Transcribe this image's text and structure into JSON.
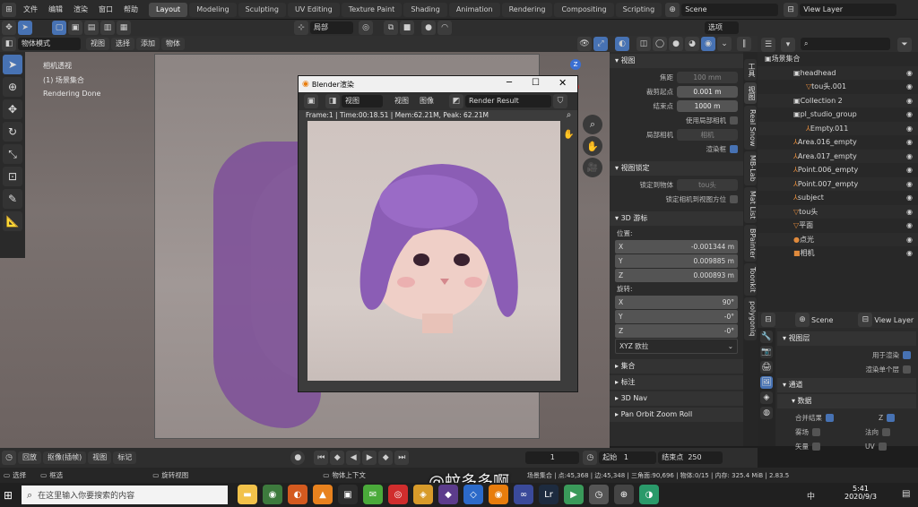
{
  "topbar": {
    "menus": [
      "文件",
      "编辑",
      "渲染",
      "窗口",
      "帮助"
    ],
    "workspaces": [
      "Layout",
      "Modeling",
      "Sculpting",
      "UV Editing",
      "Texture Paint",
      "Shading",
      "Animation",
      "Rendering",
      "Compositing",
      "Scripting"
    ],
    "active_workspace": "Layout",
    "scene": "Scene",
    "view_layer": "View Layer"
  },
  "toolbar2": {
    "orientation": "局部",
    "options": "选项"
  },
  "viewport_header": {
    "mode": "物体模式",
    "menus": [
      "视图",
      "选择",
      "添加",
      "物体"
    ]
  },
  "viewport": {
    "camera_label": "相机透视",
    "collection_label": "(1) 场景集合",
    "status": "Rendering Done"
  },
  "render_window": {
    "title": "Blender渲染",
    "view_menu": "视图",
    "menus": [
      "视图",
      "图像"
    ],
    "slot": "Render Result",
    "stats": "Frame:1 | Time:00:18.51 | Mem:62.21M, Peak: 62.21M"
  },
  "npanel": {
    "view_section": "视图",
    "focal_label": "焦距",
    "focal_value": "100 mm",
    "clip_start_label": "裁剪起点",
    "clip_start_value": "0.001 m",
    "clip_end_label": "结束点",
    "clip_end_value": "1000 m",
    "local_camera_label": "使用局部相机",
    "local_camera_field_label": "局部相机",
    "local_camera_value": "相机",
    "render_region_label": "渲染框",
    "view_lock_section": "视图锁定",
    "lock_to_object_label": "锁定到物体",
    "lock_to_object_value": "tou头",
    "lock_camera_label": "锁定相机到视图方位",
    "cursor_section": "3D 游标",
    "location_label": "位置:",
    "loc_x": "-0.001344 m",
    "loc_y": "0.009885 m",
    "loc_z": "0.000893 m",
    "rotation_label": "旋转:",
    "rot_x": "90°",
    "rot_y": "-0°",
    "rot_z": "-0°",
    "rotation_mode": "XYZ 欧拉",
    "collections_section": "集合",
    "annotations_section": "标注",
    "nav_section": "3D Nav",
    "pan_section": "Pan Orbit Zoom Roll"
  },
  "vtabs": [
    "工具",
    "视图",
    "Real Snow",
    "MB-Lab",
    "Mat List",
    "BPainter",
    "Toonkit",
    "polygoniq"
  ],
  "outliner": {
    "title": "场景集合",
    "items": [
      {
        "name": "headhead",
        "icon": "▣"
      },
      {
        "name": "tou头.001",
        "icon": "▽"
      },
      {
        "name": "Collection 2",
        "icon": "▣"
      },
      {
        "name": "pl_studio_group",
        "icon": "▣"
      },
      {
        "name": "Empty.011",
        "icon": "⅄"
      },
      {
        "name": "Area.016_empty",
        "icon": "⅄"
      },
      {
        "name": "Area.017_empty",
        "icon": "⅄"
      },
      {
        "name": "Point.006_empty",
        "icon": "⅄"
      },
      {
        "name": "Point.007_empty",
        "icon": "⅄"
      },
      {
        "name": "subject",
        "icon": "⅄"
      },
      {
        "name": "tou头",
        "icon": "▽"
      },
      {
        "name": "平面",
        "icon": "▽"
      },
      {
        "name": "点光",
        "icon": "●"
      },
      {
        "name": "相机",
        "icon": "■"
      }
    ]
  },
  "props2": {
    "scene": "Scene",
    "view_layer": "View Layer",
    "layer_section": "视图层",
    "use_for_render": "用于渲染",
    "render_single": "渲染单个层",
    "passes_section": "通道",
    "data_section": "数据",
    "combined": "合并结果",
    "z": "Z",
    "mist": "雾场",
    "normal": "法向",
    "vector": "矢量",
    "uv": "UV"
  },
  "timeline": {
    "playback": "回放",
    "keying": "抠像(插帧)",
    "view": "视图",
    "marker": "标记",
    "current_frame": "1",
    "start_label": "起始",
    "start_value": "1",
    "end_label": "结束点",
    "end_value": "250"
  },
  "statusbar": {
    "select": "选择",
    "box_select": "框选",
    "rotate_view": "旋转视图",
    "context_menu": "物体上下文",
    "stats": "场景集合 | 点:45,368 | 边:45,348 | 三角面:90,696 | 物体:0/15 | 内存: 325.4 MiB | 2.83.5"
  },
  "taskbar": {
    "search_placeholder": "在这里输入你要搜索的内容",
    "time": "5:41",
    "date": "2020/9/3",
    "ime": "中"
  },
  "watermark": "@蚊多多啊",
  "colors": {
    "accent": "#4772b3",
    "hair": "#8b5db5",
    "bg": "#1d1d1d"
  }
}
